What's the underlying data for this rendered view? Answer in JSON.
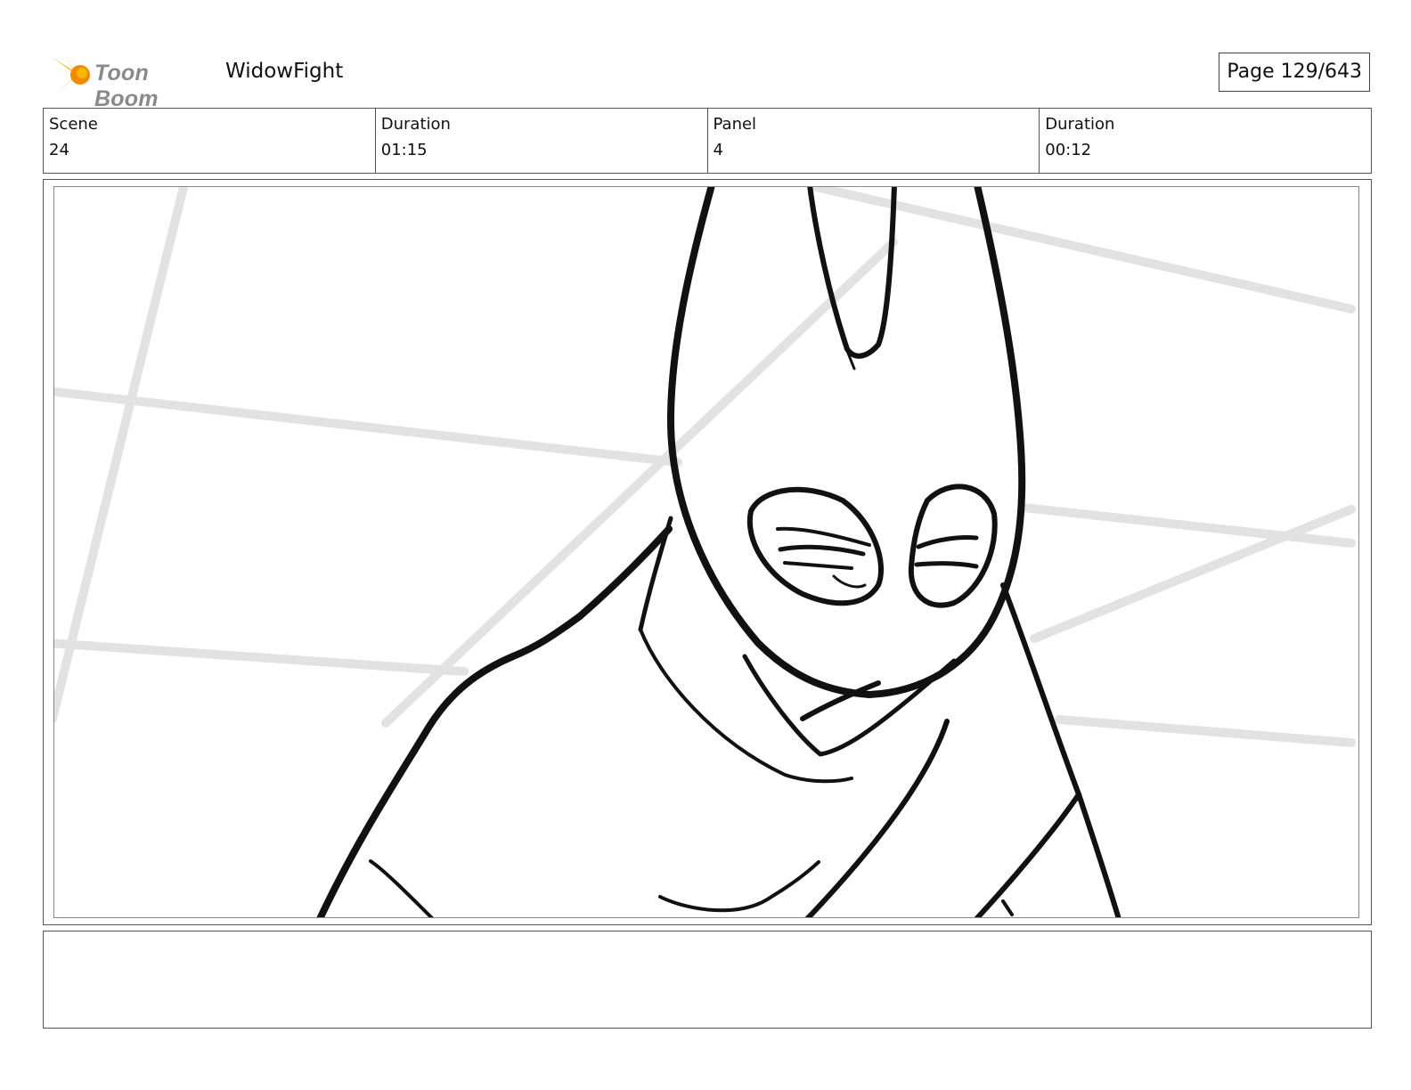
{
  "header": {
    "logo_text": "Toon Boom",
    "project": "WidowFight",
    "page": "Page 129/643"
  },
  "info": {
    "scene_label": "Scene",
    "scene_value": "24",
    "duration_label": "Duration",
    "duration_value": "01:15",
    "panel_label": "Panel",
    "panel_value": "4",
    "panel_duration_label": "Duration",
    "panel_duration_value": "00:12"
  },
  "colors": {
    "logo_yellow": "#f5b800",
    "logo_orange": "#f08a00",
    "sketch_line": "#111111",
    "guide_line": "#e2e2e2"
  },
  "notes": ""
}
